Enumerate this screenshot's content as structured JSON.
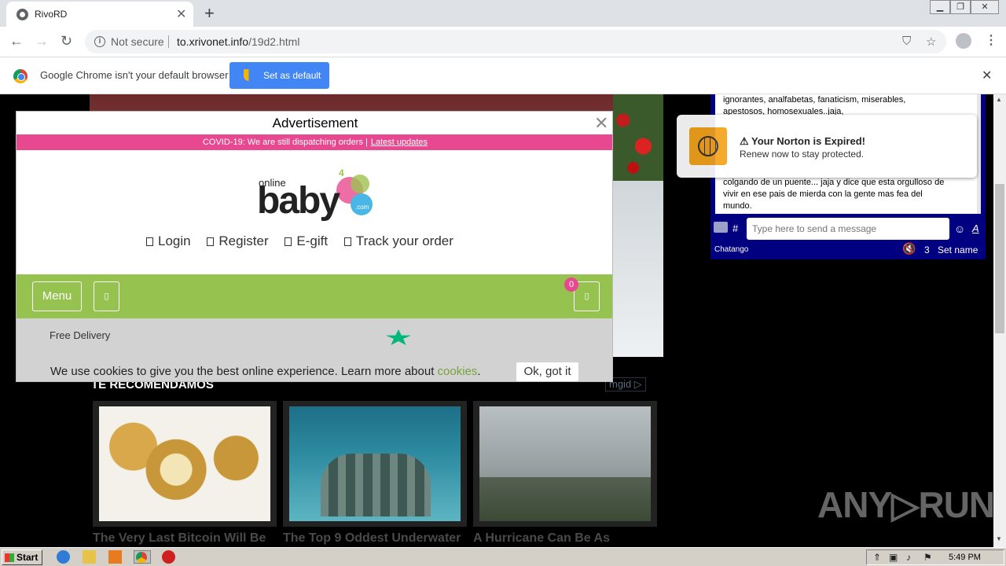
{
  "browser": {
    "tab_title": "RivoRD",
    "not_secure": "Not secure",
    "url_host": "to.xrivonet.info",
    "url_path": "/19d2.html",
    "infobar_text": "Google Chrome isn't your default browser",
    "set_default_label": "Set as default"
  },
  "ad": {
    "heading": "Advertisement",
    "covid_text": "COVID-19: We are still dispatching orders |",
    "covid_link": "Latest updates",
    "logo_small": "online",
    "logo_four": "4",
    "logo_main": "baby",
    "logo_com": ".com",
    "links": [
      "Login",
      "Register",
      "E-gift",
      "Track your order"
    ],
    "menu_label": "Menu",
    "cart_count": "0",
    "placeholder_glyph": "▯",
    "delivery_text": "Free Delivery",
    "cookie_text": "We use cookies to give you the best online experience. Learn more about",
    "cookie_link": "cookies",
    "cookie_period": ".",
    "ok_label": "Ok, got it"
  },
  "page": {
    "recommend_title": "TE RECOMENDAMOS",
    "mgid_label": "mgid",
    "cards": [
      {
        "caption": "The Very Last Bitcoin Will Be"
      },
      {
        "caption": "The Top 9 Oddest Underwater"
      },
      {
        "caption": "A Hurricane Can Be As"
      }
    ]
  },
  "chat": {
    "lines": [
      "ignorantes, analfabetas, fanaticism, miserables,",
      "apestosos, homosexuales..jaja,",
      "",
      "",
      "",
      "",
      "",
      "colgando de un puente... jaja y dice que esta orgulloso de",
      "vivir en ese pais de mierda con la gente mas fea del",
      "mundo."
    ],
    "input_placeholder": "Type here to send a message",
    "brand": "Chatango",
    "user_count": "3",
    "set_name": "Set name"
  },
  "norton": {
    "title": "⚠ Your Norton is Expired!",
    "subtitle": "Renew now to stay protected."
  },
  "watermark": "ANY▷RUN",
  "taskbar": {
    "start_label": "Start",
    "time": "5:49 PM"
  }
}
